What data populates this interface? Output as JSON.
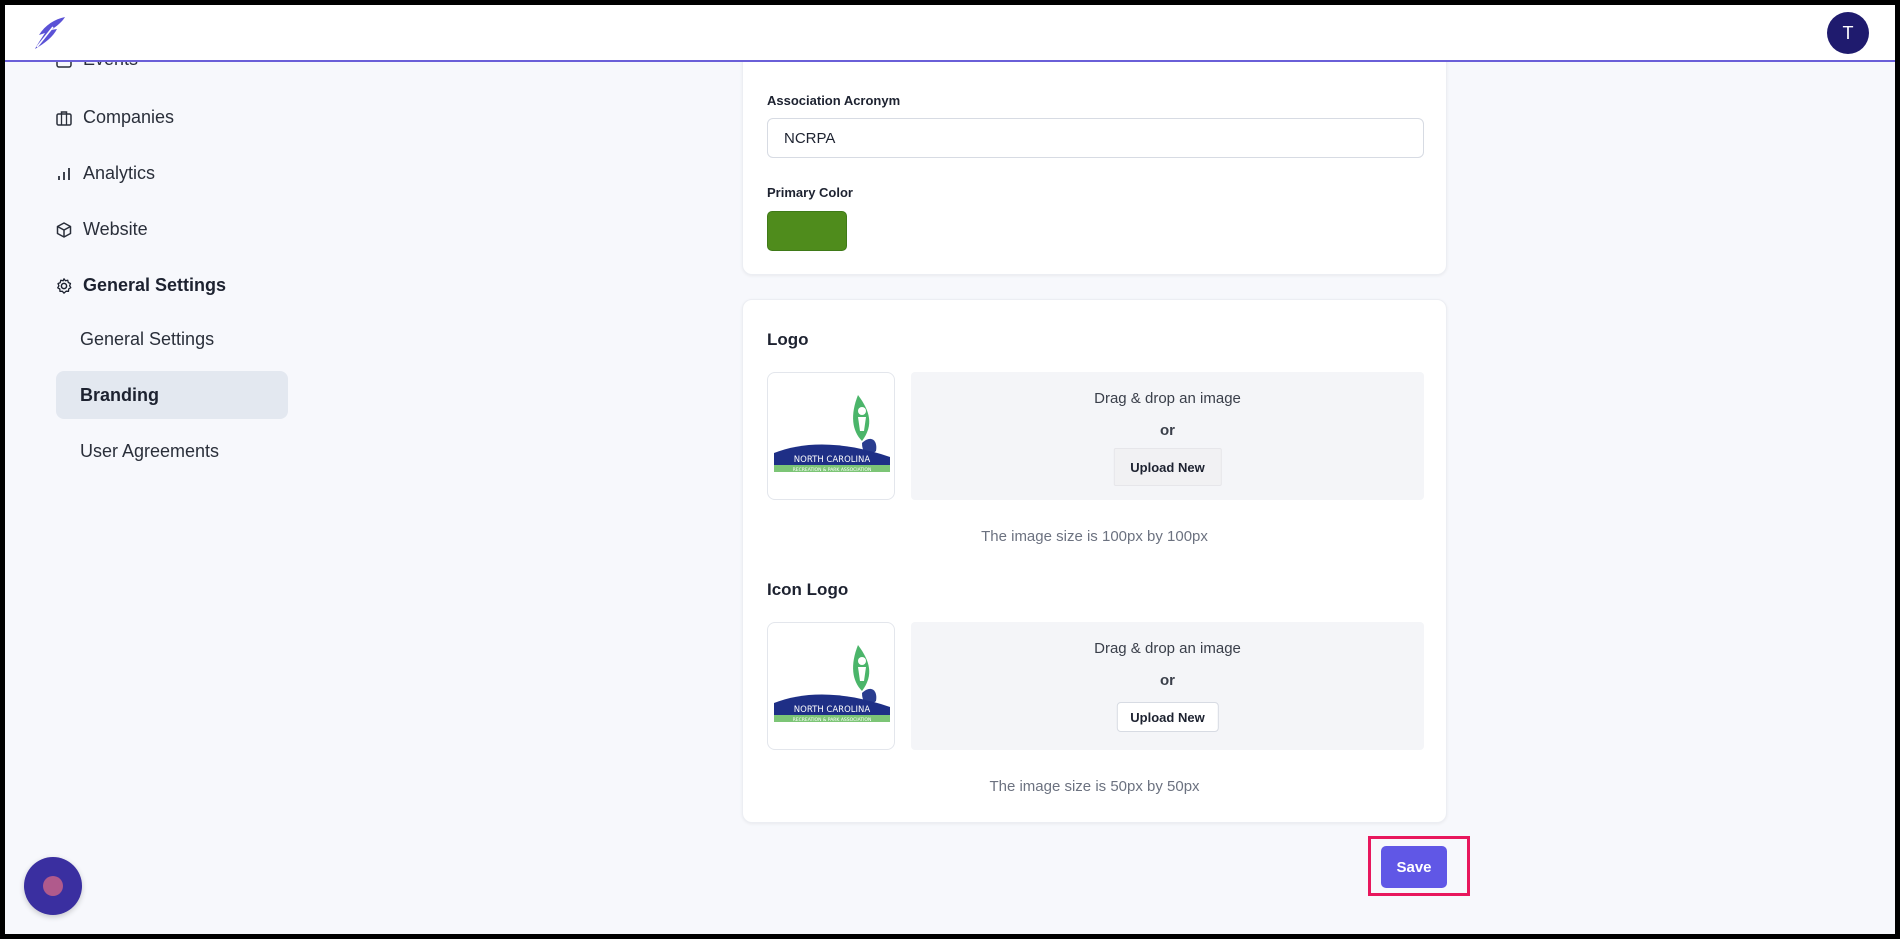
{
  "header": {
    "avatar_initial": "T"
  },
  "sidebar": {
    "items": [
      {
        "label": "Events",
        "icon": "calendar-icon"
      },
      {
        "label": "Companies",
        "icon": "briefcase-icon"
      },
      {
        "label": "Analytics",
        "icon": "bar-chart-icon"
      },
      {
        "label": "Website",
        "icon": "cube-icon"
      },
      {
        "label": "General Settings",
        "icon": "gear-icon"
      }
    ],
    "sub_items": [
      {
        "label": "General Settings",
        "active": false
      },
      {
        "label": "Branding",
        "active": true
      },
      {
        "label": "User Agreements",
        "active": false
      }
    ]
  },
  "form": {
    "acronym_label": "Association Acronym",
    "acronym_value": "NCRPA",
    "color_label": "Primary Color",
    "primary_color": "#4f8c1c"
  },
  "logo_section": {
    "title": "Logo",
    "drop_text": "Drag & drop an image",
    "or_text": "or",
    "upload_label": "Upload New",
    "hint": "The image size is 100px by 100px",
    "logo_text_main": "NORTH CAROLINA",
    "logo_text_sub": "RECREATION & PARK ASSOCIATION"
  },
  "icon_logo_section": {
    "title": "Icon Logo",
    "drop_text": "Drag & drop an image",
    "or_text": "or",
    "upload_label": "Upload New",
    "hint": "The image size is 50px by 50px",
    "logo_text_main": "NORTH CAROLINA",
    "logo_text_sub": "RECREATION & PARK ASSOCIATION"
  },
  "actions": {
    "save_label": "Save"
  },
  "colors": {
    "accent": "#6057e6",
    "highlight": "#e8175d",
    "avatar_bg": "#1f1b6e"
  }
}
